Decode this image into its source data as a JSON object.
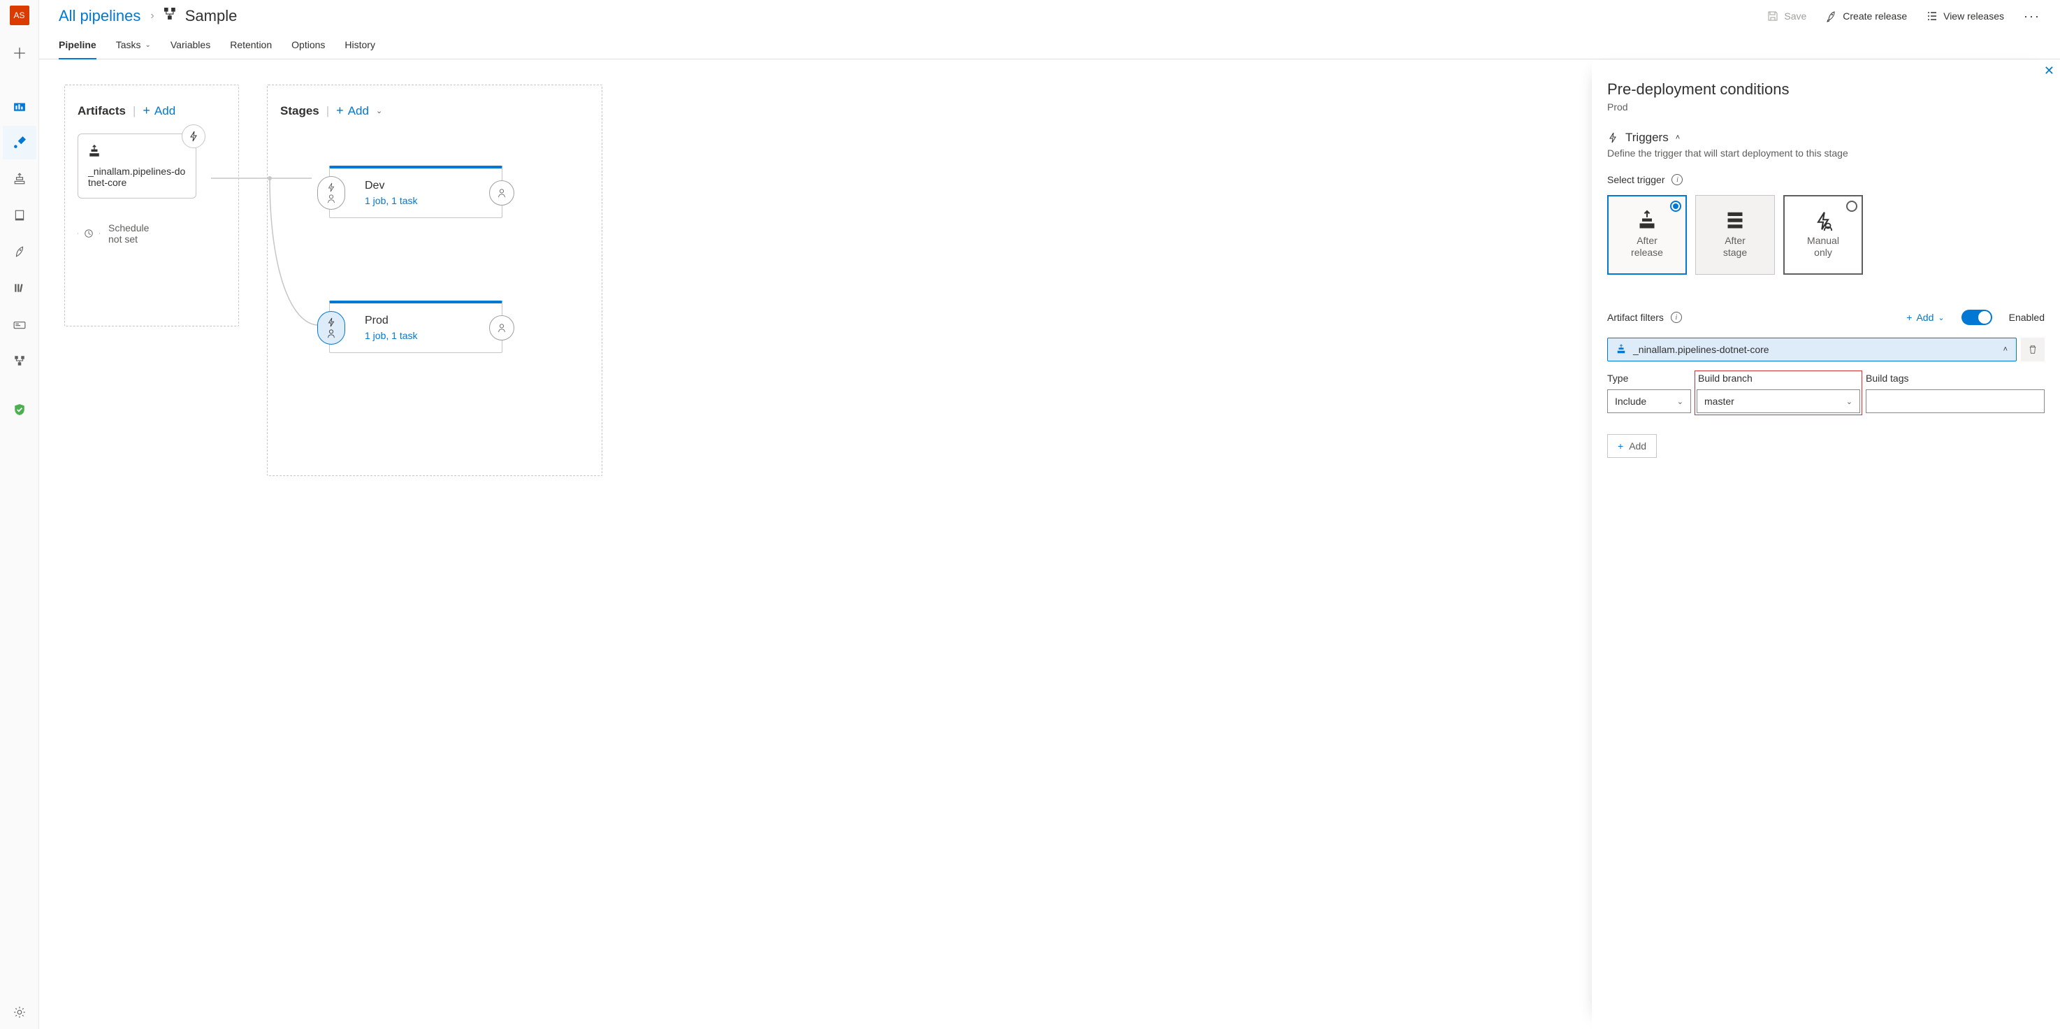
{
  "avatar_initials": "AS",
  "breadcrumb": {
    "all_pipelines": "All pipelines",
    "title": "Sample"
  },
  "header_actions": {
    "save": "Save",
    "create_release": "Create release",
    "view_releases": "View releases"
  },
  "tabs": {
    "pipeline": "Pipeline",
    "tasks": "Tasks",
    "variables": "Variables",
    "retention": "Retention",
    "options": "Options",
    "history": "History"
  },
  "canvas": {
    "artifacts_header": "Artifacts",
    "stages_header": "Stages",
    "add": "Add",
    "artifact_name": "_ninallam.pipelines-dotnet-core",
    "schedule_label": "Schedule not set",
    "stages": [
      {
        "name": "Dev",
        "detail": "1 job, 1 task"
      },
      {
        "name": "Prod",
        "detail": "1 job, 1 task"
      }
    ]
  },
  "panel": {
    "title": "Pre-deployment conditions",
    "stage": "Prod",
    "triggers_header": "Triggers",
    "triggers_desc": "Define the trigger that will start deployment to this stage",
    "select_trigger": "Select trigger",
    "tiles": {
      "after_release": "After release",
      "after_stage": "After stage",
      "manual_only": "Manual only"
    },
    "artifact_filters": "Artifact filters",
    "add": "Add",
    "enabled": "Enabled",
    "filter_name": "_ninallam.pipelines-dotnet-core",
    "columns": {
      "type": "Type",
      "branch": "Build branch",
      "tags": "Build tags"
    },
    "type_value": "Include",
    "branch_value": "master"
  }
}
